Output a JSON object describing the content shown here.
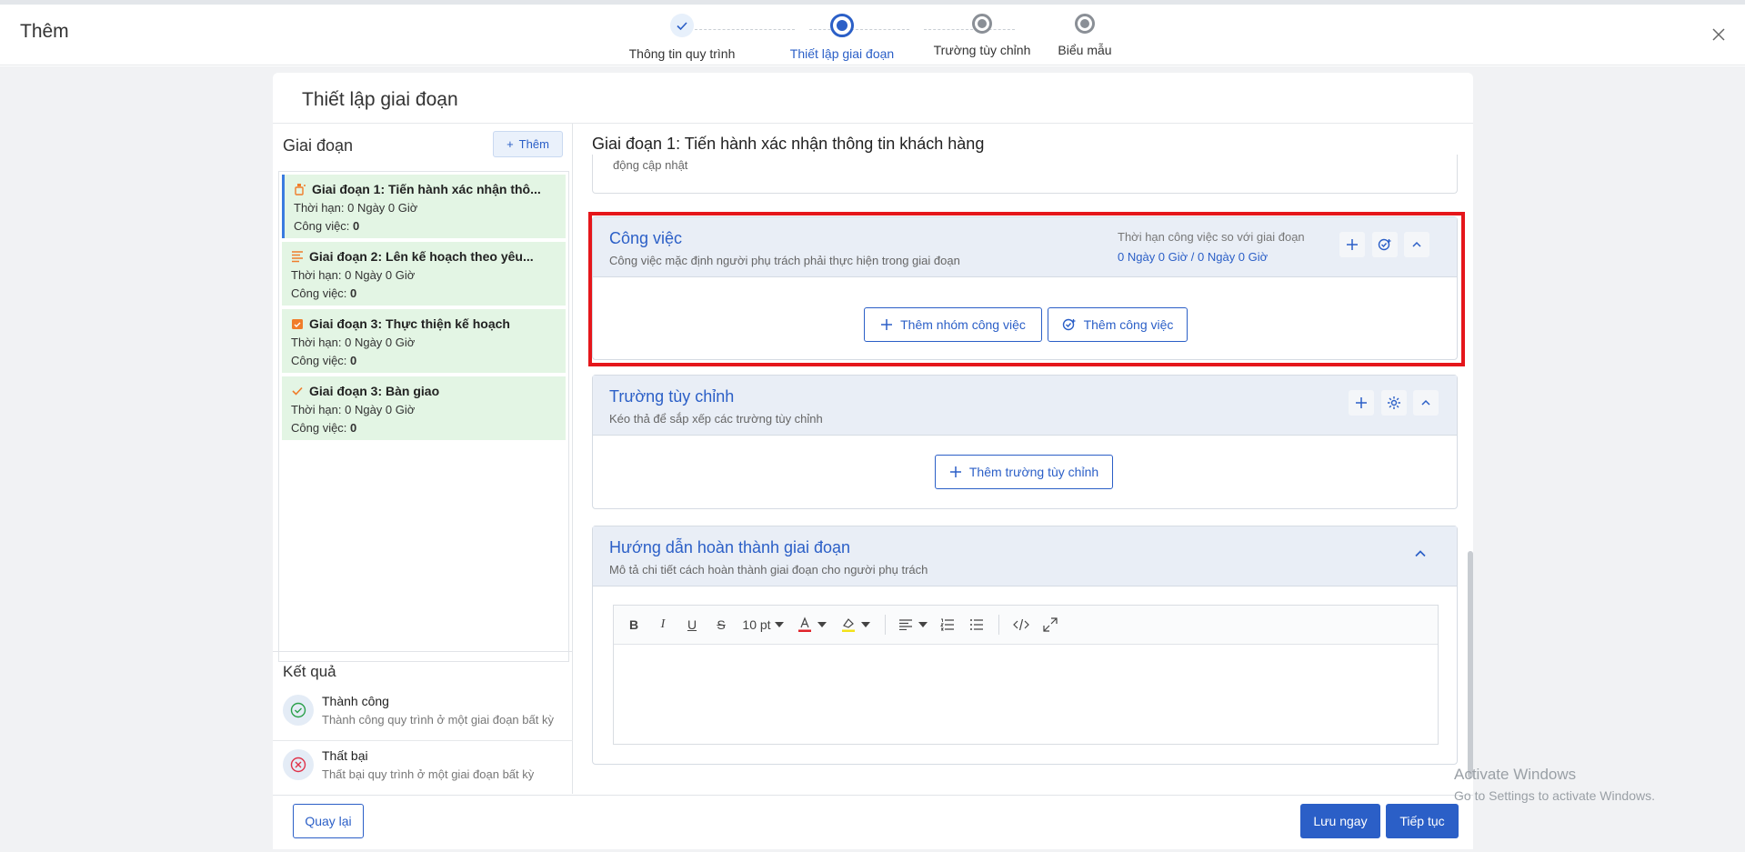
{
  "header": {
    "title": "Thêm"
  },
  "stepper": {
    "steps": [
      {
        "label": "Thông tin quy trình",
        "state": "done"
      },
      {
        "label": "Thiết lập giai đoạn",
        "state": "active"
      },
      {
        "label": "Trường tùy chỉnh",
        "state": "todo"
      },
      {
        "label": "Biểu mẫu",
        "state": "todo"
      }
    ]
  },
  "card": {
    "title": "Thiết lập giai đoạn"
  },
  "stages": {
    "heading": "Giai đoạn",
    "add_label": "Thêm",
    "items": [
      {
        "name": "Giai đoạn 1: Tiến hành xác nhận thô...",
        "deadline": "Thời hạn: 0 Ngày 0 Giờ",
        "tasks_label": "Công việc:",
        "tasks_count": "0",
        "icon": "bottle-icon",
        "icon_color": "#f07d2a"
      },
      {
        "name": "Giai đoạn 2: Lên kế hoạch theo yêu...",
        "deadline": "Thời hạn: 0 Ngày 0 Giờ",
        "tasks_label": "Công việc:",
        "tasks_count": "0",
        "icon": "list-icon",
        "icon_color": "#f07d2a"
      },
      {
        "name": "Giai đoạn 3: Thực thiện kế hoạch",
        "deadline": "Thời hạn: 0 Ngày 0 Giờ",
        "tasks_label": "Công việc:",
        "tasks_count": "0",
        "icon": "calendar-icon",
        "icon_color": "#f07d2a"
      },
      {
        "name": "Giai đoạn 3: Bàn giao",
        "deadline": "Thời hạn: 0 Ngày 0 Giờ",
        "tasks_label": "Công việc:",
        "tasks_count": "0",
        "icon": "check-icon",
        "icon_color": "#f07d2a"
      }
    ]
  },
  "results": {
    "heading": "Kết quả",
    "success": {
      "title": "Thành công",
      "desc": "Thành công quy trình ở một giai đoạn bất kỳ"
    },
    "failure": {
      "title": "Thất bại",
      "desc": "Thất bại quy trình ở một giai đoạn bất kỳ"
    }
  },
  "detail": {
    "heading": "Giai đoạn 1: Tiến hành xác nhận thông tin khách hàng",
    "prev_text": "động cập nhật"
  },
  "tasks_section": {
    "title": "Công việc",
    "subtitle": "Công việc mặc định người phụ trách phải thực hiện trong giai đoạn",
    "deadline_label": "Thời hạn công việc so với giai đoạn",
    "deadline_value": "0 Ngày 0 Giờ / 0 Ngày 0 Giờ",
    "add_group_label": "Thêm nhóm công việc",
    "add_task_label": "Thêm công việc"
  },
  "custom_section": {
    "title": "Trường tùy chỉnh",
    "subtitle": "Kéo thả để sắp xếp các trường tùy chỉnh",
    "add_label": "Thêm trường tùy chỉnh"
  },
  "guide_section": {
    "title": "Hướng dẫn hoàn thành giai đoạn",
    "subtitle": "Mô tả chi tiết cách hoàn thành giai đoạn cho người phụ trách",
    "font_size": "10 pt"
  },
  "footer": {
    "back_label": "Quay lại",
    "save_label": "Lưu ngay",
    "next_label": "Tiếp tục"
  },
  "watermark": {
    "line1": "Activate Windows",
    "line2": "Go to Settings to activate Windows."
  },
  "colors": {
    "accent": "#2b5fc7",
    "stage_bg": "#e3f5e4",
    "highlight": "#e5161b"
  }
}
